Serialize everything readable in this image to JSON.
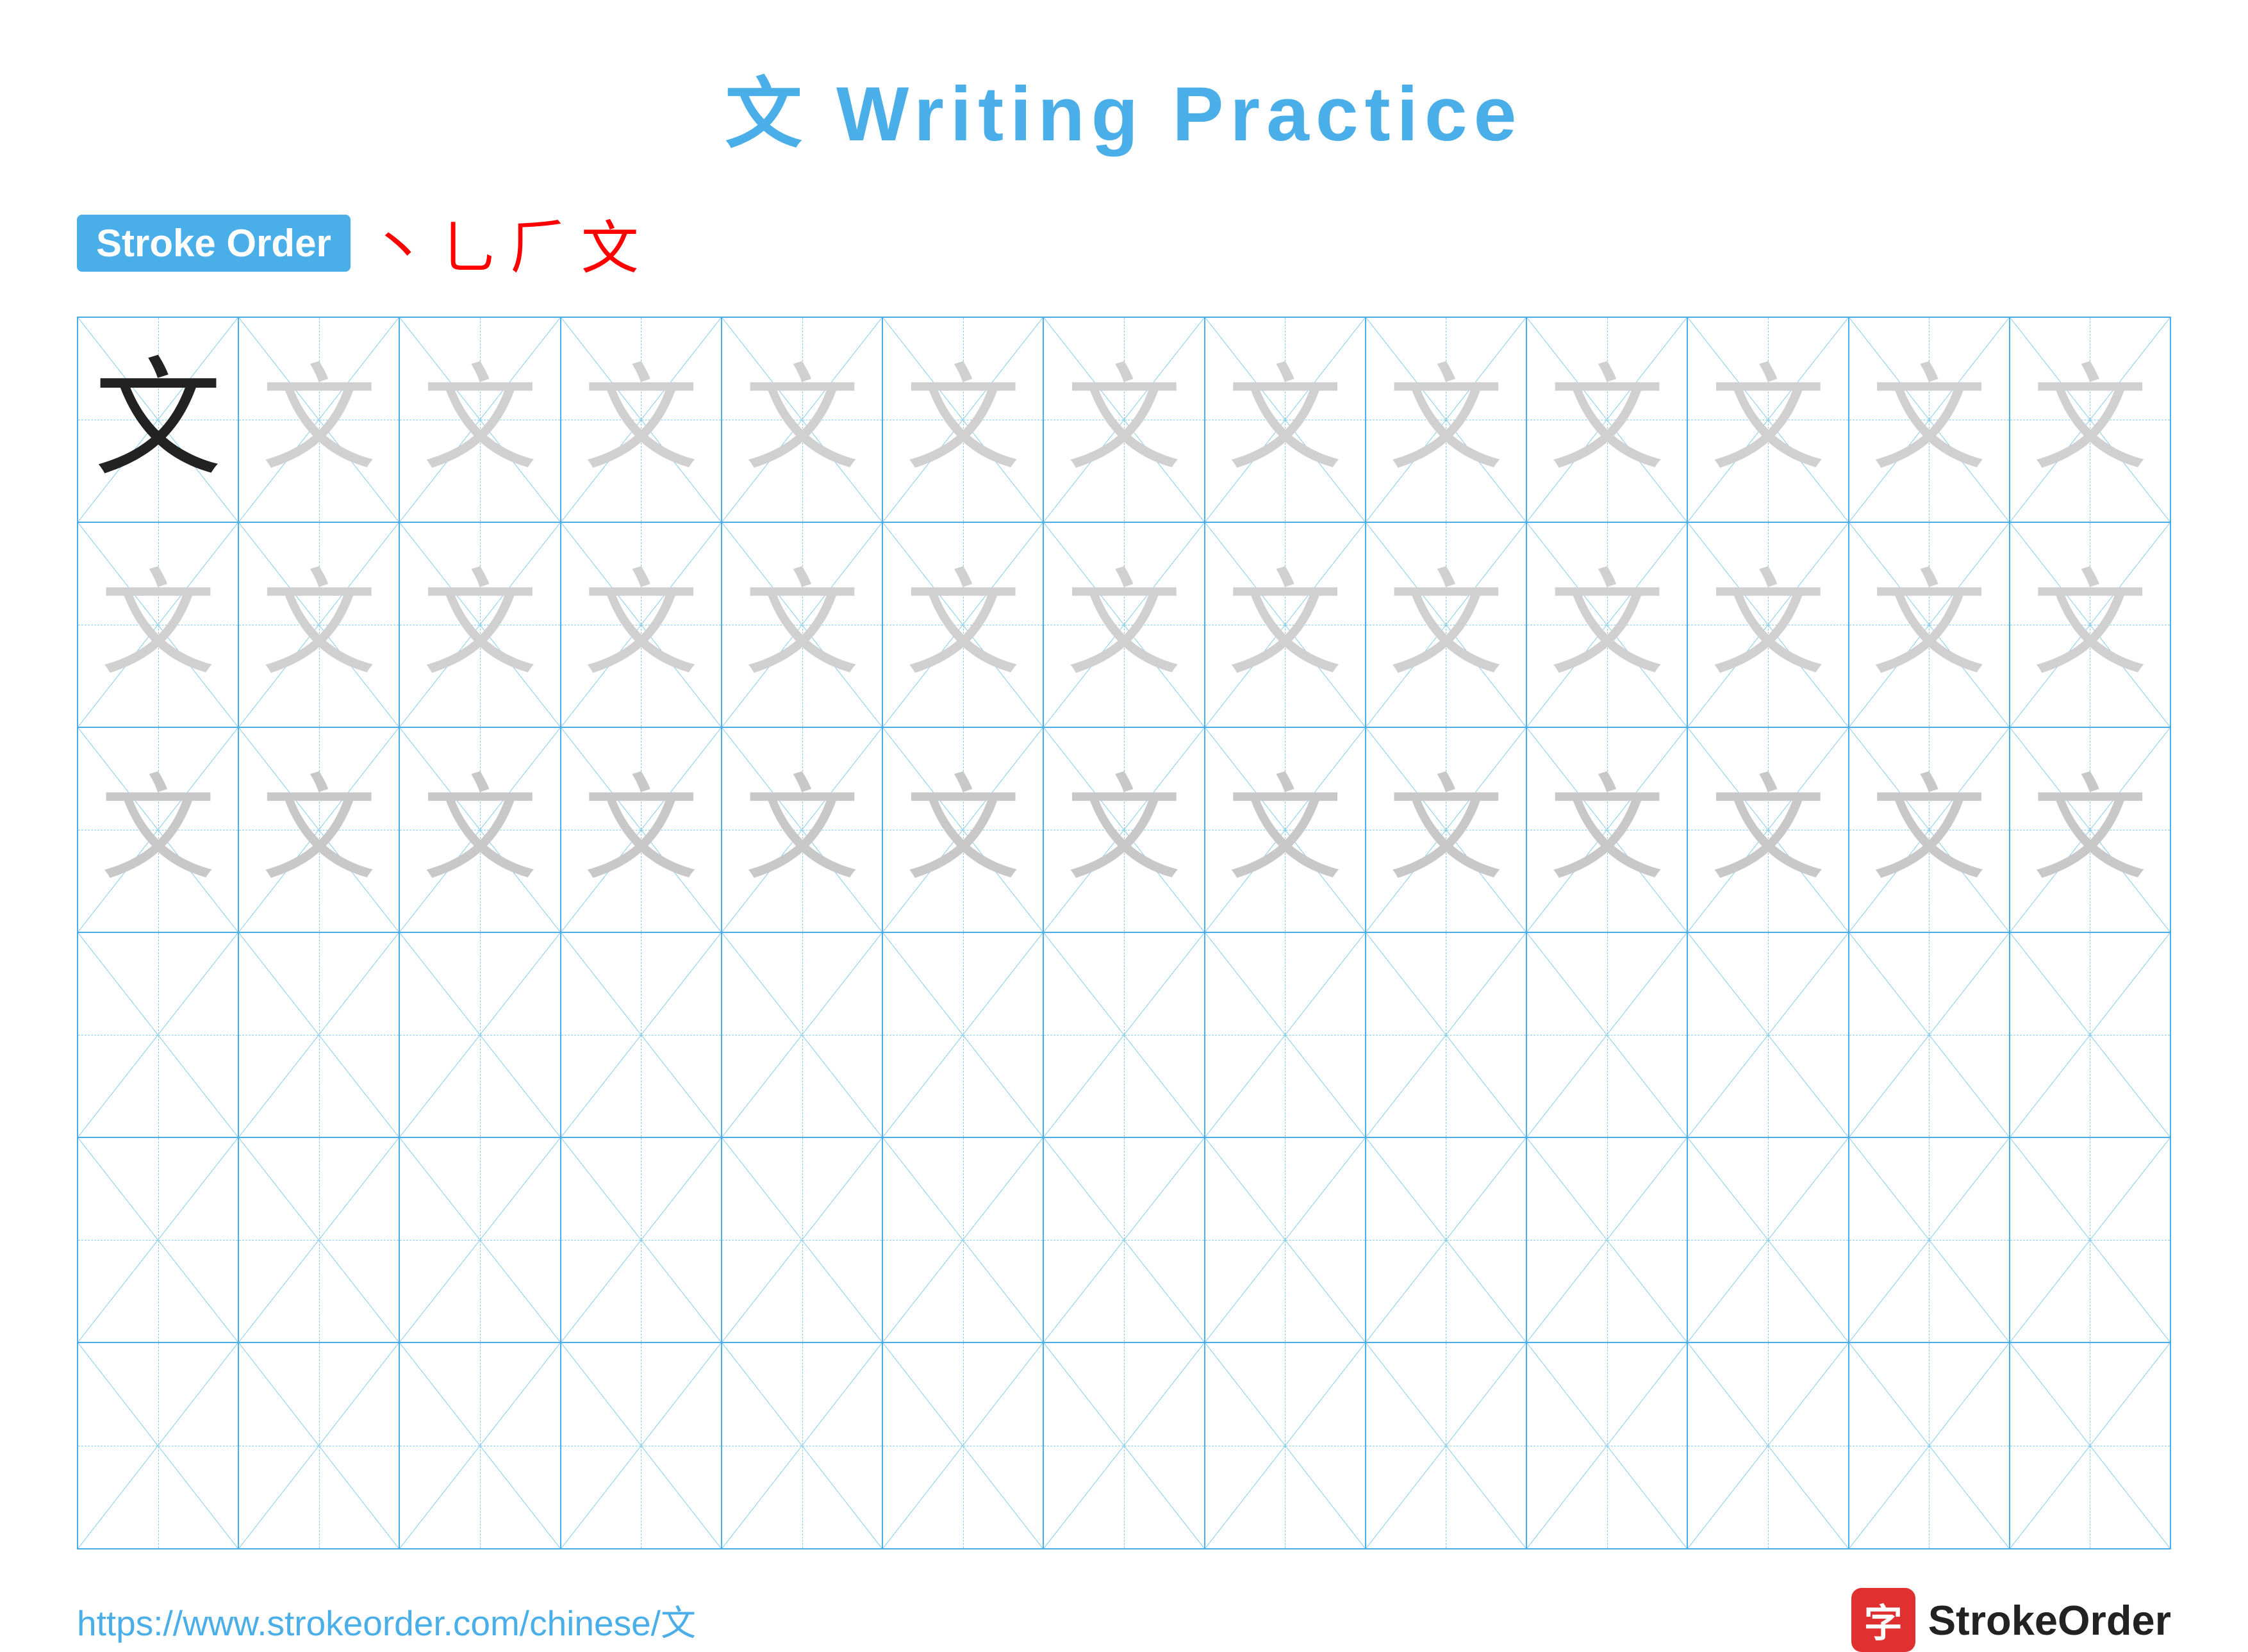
{
  "title": {
    "char": "文",
    "text": "Writing Practice"
  },
  "stroke_order": {
    "badge_label": "Stroke Order",
    "strokes": [
      "丶",
      "⺃",
      "丿",
      "文"
    ]
  },
  "grid": {
    "rows": 6,
    "cols": 13,
    "guide_char": "文",
    "filled_rows": 3
  },
  "footer": {
    "url": "https://www.strokeorder.com/chinese/文",
    "brand": "StrokeOrder",
    "brand_char": "字"
  }
}
